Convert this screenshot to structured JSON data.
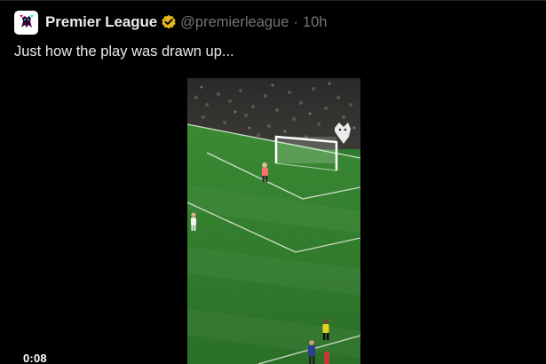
{
  "tweet": {
    "display_name": "Premier League",
    "handle": "@premierleague",
    "separator": "·",
    "time_ago": "10h",
    "text": "Just how the play was drawn up..."
  },
  "video": {
    "elapsed": "0:08"
  },
  "icons": {
    "avatar": "premier-league-lion-logo",
    "verified": "gold-verified-badge",
    "watermark": "premier-league-lion-icon"
  },
  "colors": {
    "background": "#000000",
    "text_primary": "#e7e9ea",
    "text_secondary": "#71767b",
    "verified_gold": "#e2b719",
    "pitch_green": "#2f7a2b"
  }
}
